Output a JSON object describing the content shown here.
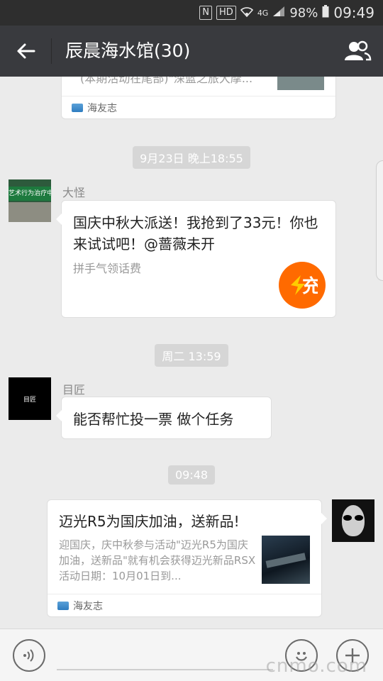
{
  "statusbar": {
    "nfc": "N",
    "hd": "HD",
    "network": "4G",
    "battery": "98%",
    "time": "09:49"
  },
  "titlebar": {
    "title": "辰晨海水馆(30)"
  },
  "messages": {
    "prev_card": {
      "text": "(本期活动在尾部)\"深蓝之旅大摩...",
      "source": "海友志"
    },
    "ts1": "9月23日 晚上18:55",
    "m1": {
      "sender": "大怪",
      "avatar_sign": "艺术行为治疗中心",
      "text": "国庆中秋大派送！我抢到了33元！你也来试试吧！@蔷薇未开",
      "sub": "拼手气领话费",
      "logo_char": "充"
    },
    "ts2": "周二 13:59",
    "m2": {
      "sender": "目匠",
      "avatar_text": "目匠",
      "text": "能否帮忙投一票  做个任务"
    },
    "ts3": "09:48",
    "m3": {
      "title": "迈光R5为国庆加油，送新品!",
      "desc": "迎国庆，庆中秋参与活动\"迈光R5为国庆加油，送新品\"就有机会获得迈光新品RSX活动日期：10月01日到...",
      "source": "海友志"
    }
  },
  "inputbar": {
    "watermark": "cnmo.com"
  },
  "colors": {
    "titlebar": "#393a3e",
    "statusbar": "#2e2e2e",
    "chat_bg": "#ebebeb",
    "redpack_orange": "#ff6a00"
  }
}
